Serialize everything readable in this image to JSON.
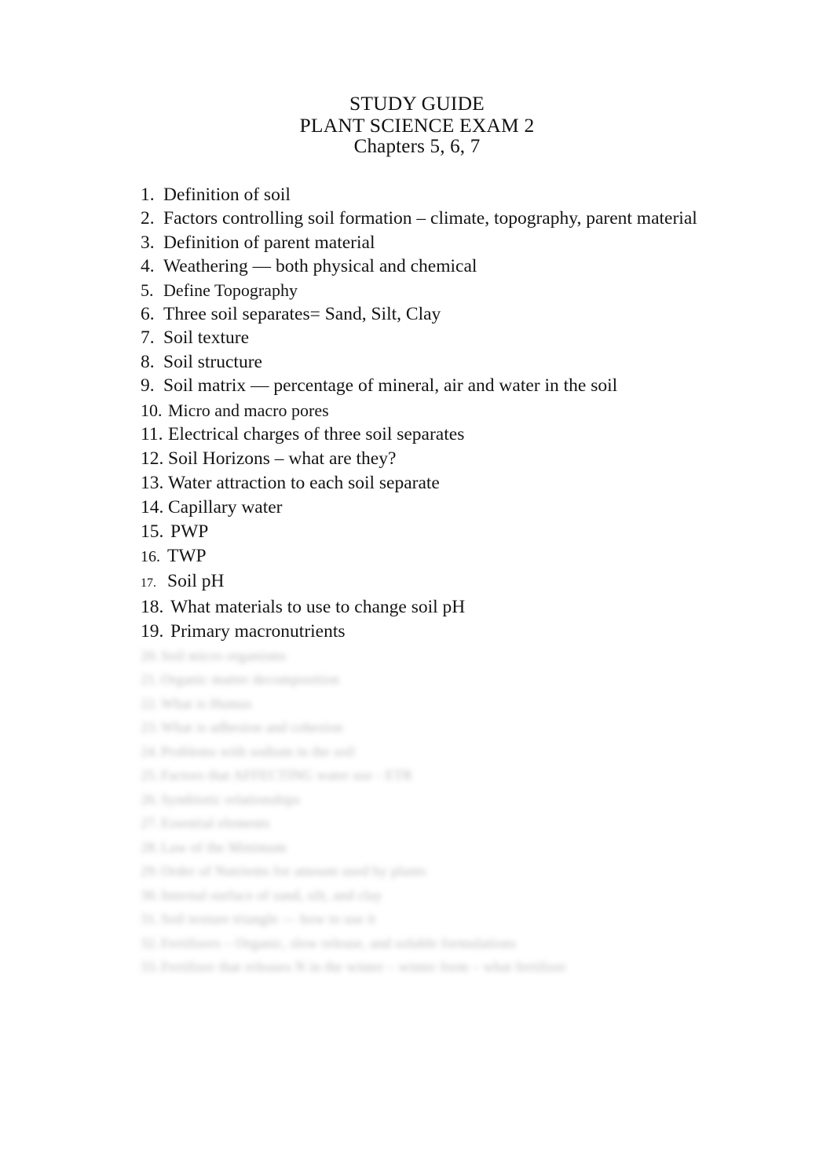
{
  "document": {
    "title_lines": [
      "STUDY GUIDE",
      "PLANT SCIENCE EXAM 2",
      "Chapters 5, 6, 7"
    ]
  },
  "list": {
    "items": [
      {
        "num": "1.",
        "text": "Definition of soil",
        "style": "s1",
        "blurred": false
      },
      {
        "num": "2.",
        "text": "Factors controlling soil formation – climate, topography, parent material",
        "style": "s1",
        "blurred": false
      },
      {
        "num": "3.",
        "text": "Definition of parent material",
        "style": "s1",
        "blurred": false
      },
      {
        "num": "4.",
        "text": "Weathering — both physical and chemical",
        "style": "s1",
        "blurred": false
      },
      {
        "num": "5.",
        "text": "Define Topography",
        "style": "s2",
        "blurred": false
      },
      {
        "num": "6.",
        "text": "Three soil separates= Sand, Silt, Clay",
        "style": "s1",
        "blurred": false
      },
      {
        "num": "7.",
        "text": "Soil texture",
        "style": "s1",
        "blurred": false
      },
      {
        "num": "8.",
        "text": "Soil structure",
        "style": "s1",
        "blurred": false
      },
      {
        "num": "9.",
        "text": "Soil matrix — percentage of mineral, air and water in the soil",
        "style": "s1",
        "blurred": false
      },
      {
        "num": "10.",
        "text": "Micro and macro pores",
        "style": "s4",
        "blurred": false
      },
      {
        "num": "11.",
        "text": "Electrical charges of three soil separates",
        "style": "s3",
        "blurred": false
      },
      {
        "num": "12.",
        "text": "Soil Horizons – what are they?",
        "style": "s3",
        "blurred": false
      },
      {
        "num": "13.",
        "text": "Water attraction to each soil separate",
        "style": "s3",
        "blurred": false
      },
      {
        "num": "14.",
        "text": "Capillary water",
        "style": "s3",
        "blurred": false
      },
      {
        "num": "15.",
        "text": "PWP",
        "style": "s5",
        "blurred": false
      },
      {
        "num": "16.",
        "text": "TWP",
        "style": "s6",
        "blurred": false
      },
      {
        "num": "17.",
        "text": "Soil pH",
        "style": "s7",
        "blurred": false
      },
      {
        "num": "18.",
        "text": "What materials to use to change soil pH",
        "style": "s5",
        "blurred": false
      },
      {
        "num": "19.",
        "text": "Primary macronutrients",
        "style": "s5",
        "blurred": false
      },
      {
        "num": "20.",
        "text": "Soil micro organisms",
        "style": "s3",
        "blurred": true
      },
      {
        "num": "21.",
        "text": "Organic matter decomposition",
        "style": "s3",
        "blurred": true
      },
      {
        "num": "22.",
        "text": "What is Humus",
        "style": "s3",
        "blurred": true
      },
      {
        "num": "23.",
        "text": "What is adhesion and cohesion",
        "style": "s3",
        "blurred": true
      },
      {
        "num": "24.",
        "text": "Problems with sodium in the soil",
        "style": "s3",
        "blurred": true
      },
      {
        "num": "25.",
        "text": "Factors that AFFECTING water use - ETR",
        "style": "s3",
        "blurred": true
      },
      {
        "num": "26.",
        "text": "Symbiotic relationships",
        "style": "s3",
        "blurred": true
      },
      {
        "num": "27.",
        "text": "Essential elements",
        "style": "s3",
        "blurred": true
      },
      {
        "num": "28.",
        "text": "Law of the Minimum",
        "style": "s3",
        "blurred": true
      },
      {
        "num": "29.",
        "text": "Order of Nutrients for amount used by plants",
        "style": "s3",
        "blurred": true
      },
      {
        "num": "30.",
        "text": "Internal surface of sand, silt, and clay",
        "style": "s3",
        "blurred": true
      },
      {
        "num": "31.",
        "text": "Soil texture triangle — how to use it",
        "style": "s3",
        "blurred": true
      },
      {
        "num": "32.",
        "text": "Fertilizers – Organic, slow release, and soluble formulations",
        "style": "s3",
        "blurred": true
      },
      {
        "num": "33.",
        "text": "Fertilizer that releases N in the winter – winter form – what fertilizer",
        "style": "s3",
        "blurred": true
      }
    ]
  }
}
